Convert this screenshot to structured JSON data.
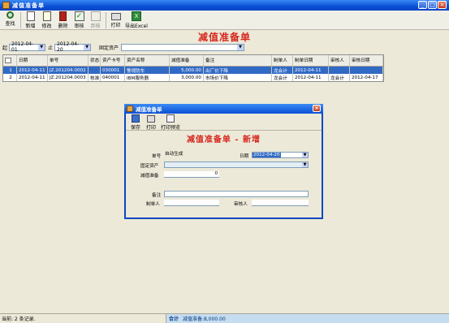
{
  "window": {
    "title": "减值准备单"
  },
  "toolbar": {
    "buttons": [
      {
        "label": "查找",
        "icon": "search-icon"
      },
      {
        "label": "新增",
        "icon": "new-doc-icon"
      },
      {
        "label": "修改",
        "icon": "edit-icon"
      },
      {
        "label": "删除",
        "icon": "trash-icon"
      },
      {
        "label": "审核",
        "icon": "approve-icon"
      },
      {
        "label": "弃核",
        "icon": "unapprove-icon"
      },
      {
        "label": "打印",
        "icon": "printer-icon"
      },
      {
        "label": "导出Excel",
        "icon": "excel-icon"
      }
    ]
  },
  "page_title": "减值准备单",
  "filters": {
    "from_label": "起",
    "from_date": "2012-04-01",
    "to_label": "止",
    "to_date": "2012-04-20",
    "asset_label": "固定资产",
    "asset_value": ""
  },
  "grid": {
    "headers": [
      "日期",
      "单号",
      "状态",
      "资产卡号",
      "资产名称",
      "减值准备",
      "备注",
      "制单人",
      "制单日期",
      "审核人",
      "审核日期"
    ],
    "rows": [
      {
        "idx": "1",
        "date": "2012-04-11",
        "no": "JZ.201204.0002",
        "status": "",
        "card": "030001",
        "name": "警视防车",
        "amount": "5,000.00",
        "note": "出厂价下降",
        "maker": "龙会计",
        "make_date": "2012-04-11",
        "auditor": "",
        "audit_date": ""
      },
      {
        "idx": "2",
        "date": "2012-04-11",
        "no": "JZ.201204.0003",
        "status": "核准",
        "card": "040001",
        "name": "IBM服务器",
        "amount": "3,000.00",
        "note": "市场价下降",
        "maker": "龙会计",
        "make_date": "2012-04-11",
        "auditor": "龙会计",
        "audit_date": "2012-04-17"
      }
    ]
  },
  "dialog": {
    "title": "减值准备单",
    "toolbar": [
      {
        "label": "保存",
        "icon": "save-icon"
      },
      {
        "label": "打印",
        "icon": "printer-icon"
      },
      {
        "label": "打印预览",
        "icon": "print-preview-icon"
      }
    ],
    "heading": "减值准备单 - 新增",
    "no_label": "单号",
    "no_value": "自动生成",
    "date_label": "日期",
    "date_value": "2012-04-20",
    "asset_label": "固定资产",
    "asset_value": "",
    "amount_label": "减值准备",
    "amount_value": "0",
    "note_label": "备注",
    "note_value": "",
    "maker_label": "制单人",
    "maker_value": "",
    "auditor_label": "审核人",
    "auditor_value": ""
  },
  "status": {
    "left": "当前: 2 条记录.",
    "tag": "合计",
    "total": "减值准备:8,000.00"
  },
  "colors": {
    "heading": "#d7261d",
    "selection": "#316ac5",
    "titlebar": "#0a4fd6"
  }
}
